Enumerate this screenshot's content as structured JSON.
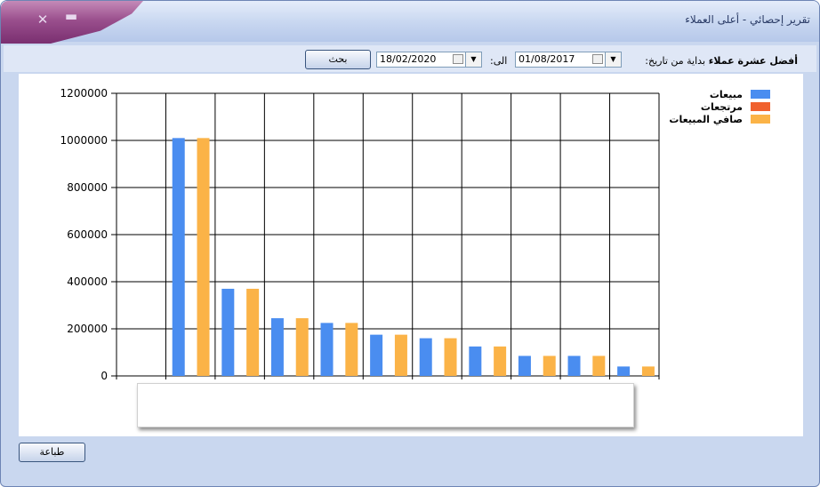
{
  "window": {
    "title": "تقرير إحصائي - أعلى العملاء"
  },
  "toolbar": {
    "heading": "أفضل عشرة عملاء",
    "from_label": "بداية من تاريخ:",
    "from_date": "01/08/2017",
    "to_label": "الى:",
    "to_date": "18/02/2020",
    "search_label": "بحث"
  },
  "footer": {
    "print_label": "طباعة"
  },
  "chart_data": {
    "type": "bar",
    "ylim": [
      0,
      1200000
    ],
    "yticks": [
      "1200000",
      "1000000",
      "800000",
      "600000",
      "400000",
      "200000",
      "0"
    ],
    "grid": true,
    "legend_position": "top-right",
    "series": [
      {
        "name": "مبيعات",
        "color": "#4a8df0",
        "values": [
          1010000,
          370000,
          245000,
          225000,
          175000,
          160000,
          125000,
          85000,
          85000,
          40000
        ]
      },
      {
        "name": "مرتجعات",
        "color": "#f0612e",
        "values": [
          0,
          0,
          0,
          0,
          0,
          0,
          0,
          0,
          0,
          0
        ]
      },
      {
        "name": "صافي المبيعات",
        "color": "#fbb347",
        "values": [
          1010000,
          370000,
          245000,
          225000,
          175000,
          160000,
          125000,
          85000,
          85000,
          40000
        ]
      }
    ]
  }
}
